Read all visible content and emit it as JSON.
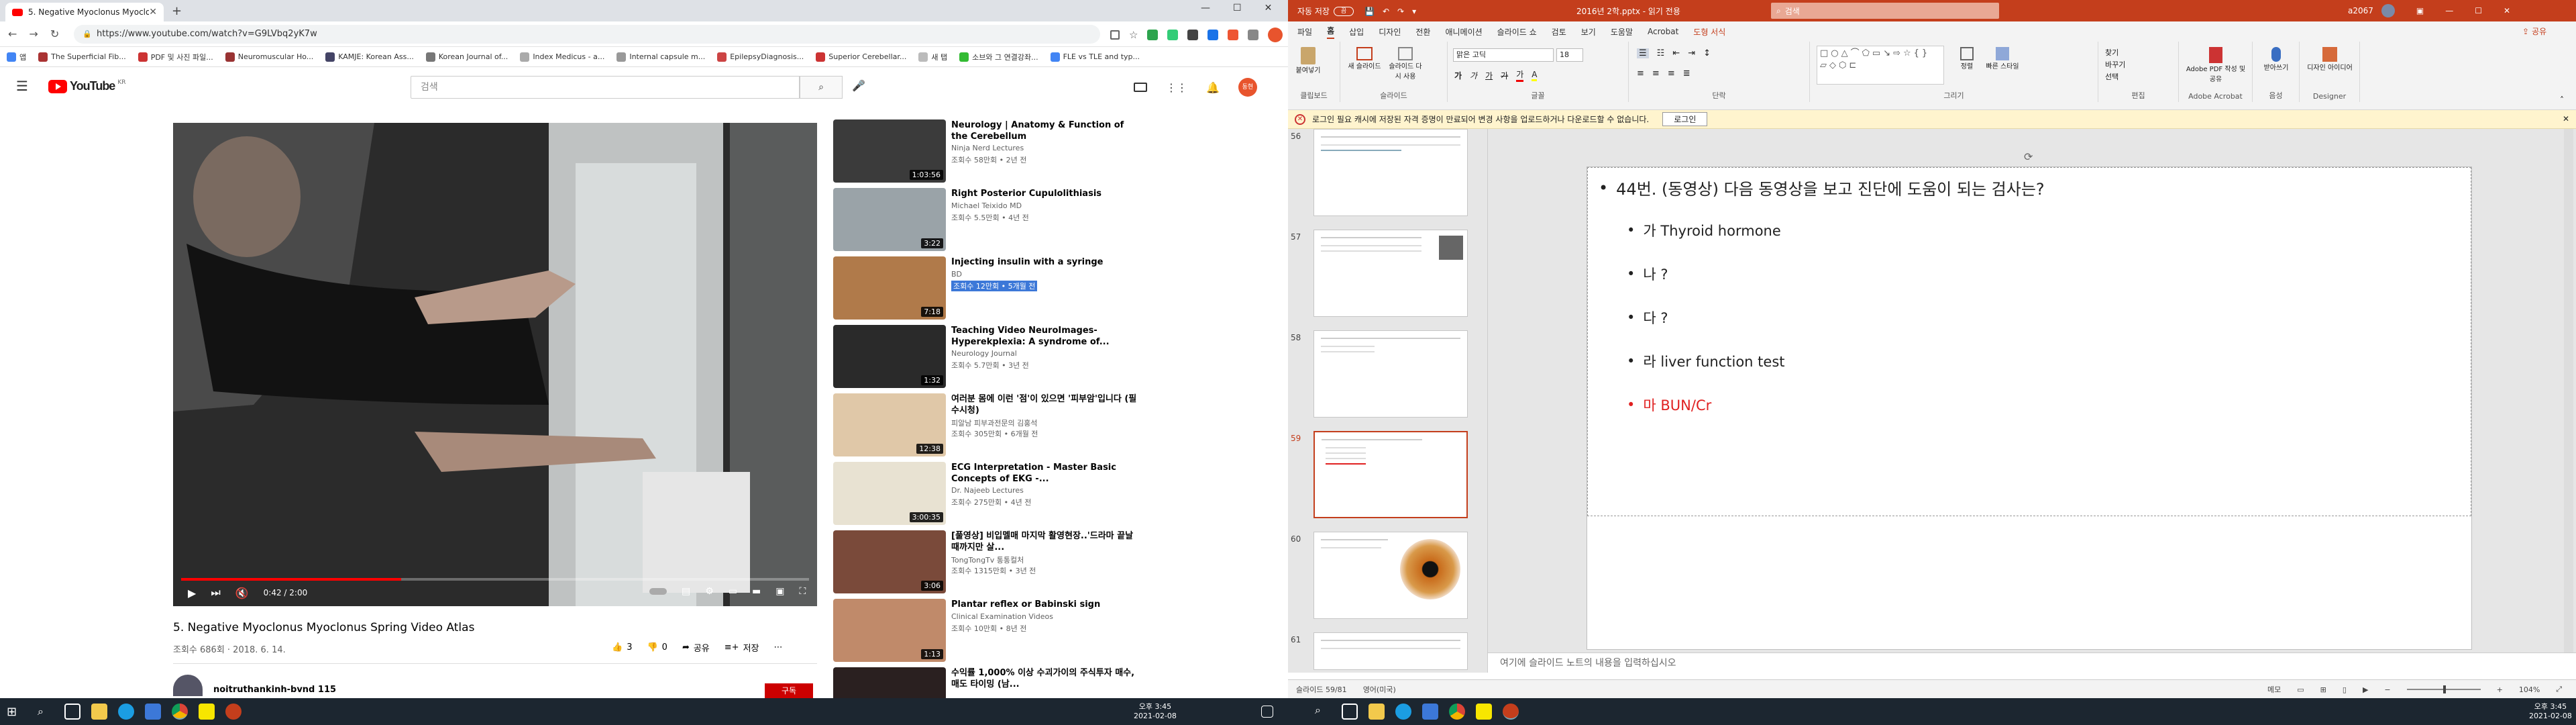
{
  "chrome": {
    "tab_title": "5. Negative Myoclonus Myoclo",
    "url": "https://www.youtube.com/watch?v=G9LVbq2yK7w",
    "bookmarks": [
      "앱",
      "The Superficial Fib...",
      "PDF 및 사진 파일...",
      "Neuromuscular Ho...",
      "KAMJE: Korean Ass...",
      "Korean Journal of...",
      "Index Medicus - a...",
      "Internal capsule m...",
      "EpilepsyDiagnosis...",
      "Superior Cerebellar...",
      "새 탭",
      "소브와 그 연결강좌...",
      "FLE vs TLE and typ..."
    ]
  },
  "youtube": {
    "logo": "YouTube",
    "logo_region": "KR",
    "search_placeholder": "검색",
    "avatar_initial": "동현",
    "video": {
      "title": "5. Negative Myoclonus Myoclonus Spring Video Atlas",
      "views_date": "조회수 686회 · 2018. 6. 14.",
      "time": "0:42 / 2:00",
      "progress": 0.35,
      "likes": "3",
      "dislikes": "0",
      "share": "공유",
      "save": "저장",
      "channel": "noitruthankinh-bvnd 115",
      "subscribe": "구독"
    },
    "recs": [
      {
        "title": "Neurology | Anatomy & Function of the Cerebellum",
        "channel": "Ninja Nerd Lectures",
        "views": "조회수 58만회 • 2년 전",
        "dur": "1:03:56",
        "color": "#3b3b3b"
      },
      {
        "title": "Right Posterior Cupulolithiasis",
        "channel": "Michael Teixido MD",
        "views": "조회수 5.5만회 • 4년 전",
        "dur": "3:22",
        "color": "#9aa3a8"
      },
      {
        "title": "Injecting insulin with a syringe",
        "channel": "BD",
        "views": "조회수 12만회 • 5개월 전",
        "dur": "7:18",
        "color": "#b07a4a"
      },
      {
        "title": "Teaching Video NeuroImages-Hyperekplexia: A syndrome of...",
        "channel": "Neurology Journal",
        "views": "조회수 5.7만회 • 3년 전",
        "dur": "1:32",
        "color": "#2a2a2a"
      },
      {
        "title": "여러분 몸에 이런 '점'이 있으면 '피부암'입니다 (필수시청)",
        "channel": "피알남 피부과전문의 김홍석",
        "views": "조회수 305만회 • 6개월 전",
        "dur": "12:38",
        "color": "#e0c8a8"
      },
      {
        "title": "ECG Interpretation - Master Basic Concepts of EKG -...",
        "channel": "Dr. Najeeb Lectures",
        "views": "조회수 275만회 • 4년 전",
        "dur": "3:00:35",
        "color": "#e8e2d2"
      },
      {
        "title": "[풀영상] 비입멜매 마지막 활영현장..'드라마 끝날 때까지만 살...",
        "channel": "TongTongTv 통통컬처",
        "views": "조회수 1315만회 • 3년 전",
        "dur": "3:06",
        "color": "#7a4a3a"
      },
      {
        "title": "Plantar reflex or Babinski sign",
        "channel": "Clinical Examination Videos",
        "views": "조회수 10만회 • 8년 전",
        "dur": "1:13",
        "color": "#c08a6a"
      },
      {
        "title": "수익률 1,000% 이상 수괴가이의 주식투자 매수, 매도 타이밍 (남...",
        "channel": "",
        "views": "",
        "dur": "",
        "color": "#2a2020"
      }
    ]
  },
  "ppt": {
    "titlebar_left": "자동 저장",
    "toggle": "끔",
    "filename": "2016년 2학.pptx - 읽기 전용",
    "search": "검색",
    "user": "a2067",
    "tabs": [
      "파일",
      "홈",
      "삽입",
      "디자인",
      "전환",
      "애니메이션",
      "슬라이드 쇼",
      "검토",
      "보기",
      "도움말",
      "Acrobat",
      "도형 서식"
    ],
    "share": "공유",
    "groups": [
      "클립보드",
      "슬라이드",
      "글꼴",
      "단락",
      "그리기",
      "편집",
      "Adobe Acrobat",
      "음성",
      "Designer"
    ],
    "ribbon_labels": {
      "paste": "붙여넣기",
      "new_slide": "새 슬라이드",
      "reuse": "슬라이드 다시 사용",
      "font": "맑은 고딕",
      "size": "18",
      "arrange": "정렬",
      "quick_styles": "빠른 스타일",
      "find": "찾기",
      "replace": "바꾸기",
      "select": "선택",
      "acrobat": "Adobe PDF 작성 및 공유",
      "dictate": "받아쓰기",
      "design": "디자인 아이디어"
    },
    "info_msg": "로그인 필요   캐시에 저장된 자격 증명이 만료되어 변경 사항을 업로드하거나 다운로드할 수 없습니다.",
    "info_btn": "로그인",
    "slide_numbers": [
      "56",
      "57",
      "58",
      "59",
      "60",
      "61"
    ],
    "slide": {
      "question": "44번. (동영상) 다음 동영상을 보고 진단에 도움이 되는 검사는?",
      "options": [
        {
          "text": "가 Thyroid hormone",
          "color": "#222222"
        },
        {
          "text": "나 ?",
          "color": "#222222"
        },
        {
          "text": "다 ?",
          "color": "#222222"
        },
        {
          "text": "라 liver function test",
          "color": "#222222"
        },
        {
          "text": "마 BUN/Cr",
          "color": "#e02020"
        }
      ]
    },
    "notes": "여기에 슬라이드 노트의 내용을 입력하십시오",
    "status_left": "슬라이드 59/81",
    "status_lang": "영어(미국)",
    "status_notes": "메모",
    "zoom": "104%"
  },
  "taskbar": {
    "time_left": "오후 3:45",
    "date_left": "2021-02-08",
    "time_right": "오후 3:45",
    "date_right": "2021-02-08"
  }
}
